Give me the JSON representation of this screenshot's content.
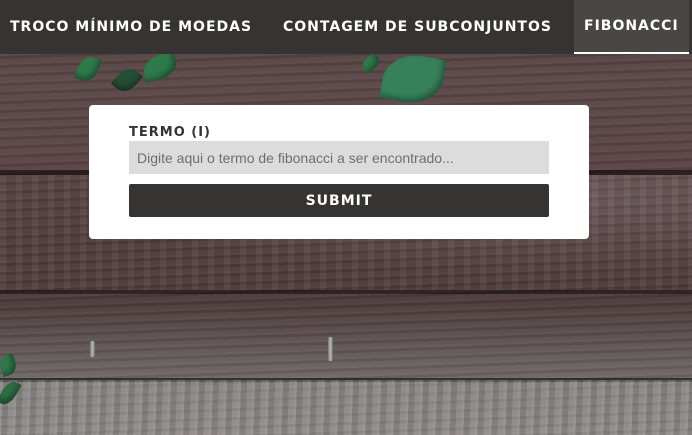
{
  "nav": {
    "items": [
      {
        "label": "TROCO MÍNIMO DE MOEDAS"
      },
      {
        "label": "CONTAGEM DE SUBCONJUNTOS"
      },
      {
        "label": "FIBONACCI"
      }
    ],
    "active": "FIBONACCI"
  },
  "form": {
    "label": "TERMO (I)",
    "input_placeholder": "Digite aqui o termo de fibonacci a ser encontrado...",
    "input_value": "",
    "submit_label": "SUBMIT"
  },
  "colors": {
    "navbar": "#353432",
    "active_tab": "#484745",
    "button": "#353432",
    "input_bg": "#dcdcdc"
  }
}
